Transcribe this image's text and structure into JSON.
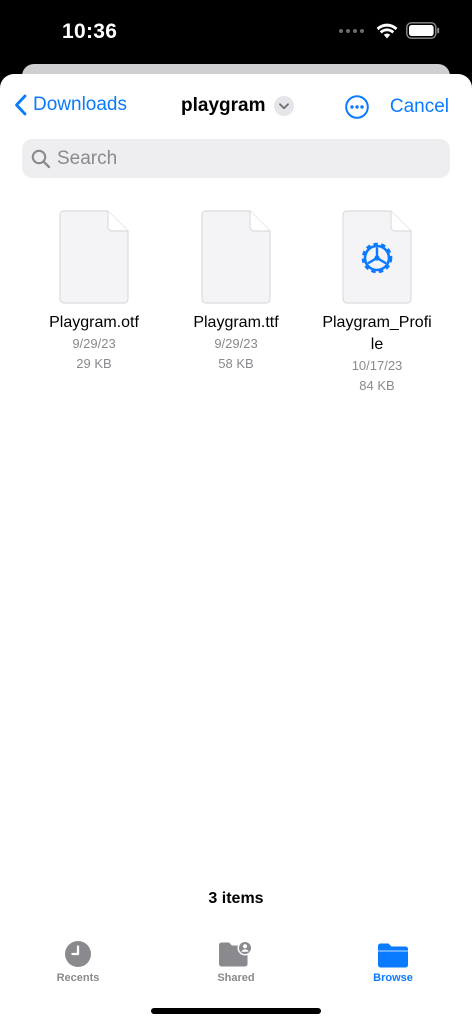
{
  "status_bar": {
    "time": "10:36"
  },
  "nav": {
    "back_label": "Downloads",
    "title": "playgram",
    "cancel_label": "Cancel"
  },
  "search": {
    "placeholder": "Search",
    "value": ""
  },
  "files": [
    {
      "name": "Playgram.otf",
      "date": "9/29/23",
      "size": "29 KB",
      "icon": "blank-document-icon"
    },
    {
      "name": "Playgram.ttf",
      "date": "9/29/23",
      "size": "58 KB",
      "icon": "blank-document-icon"
    },
    {
      "name": "Playgram_Profi\nle",
      "date": "10/17/23",
      "size": "84 KB",
      "icon": "settings-profile-document-icon"
    }
  ],
  "footer": {
    "items_count": "3 items"
  },
  "tabs": [
    {
      "label": "Recents",
      "icon": "clock-icon",
      "active": false
    },
    {
      "label": "Shared",
      "icon": "shared-folder-icon",
      "active": false
    },
    {
      "label": "Browse",
      "icon": "folder-icon",
      "active": true
    }
  ],
  "colors": {
    "accent": "#0a7aff",
    "secondary_text": "#8a8a8e"
  }
}
